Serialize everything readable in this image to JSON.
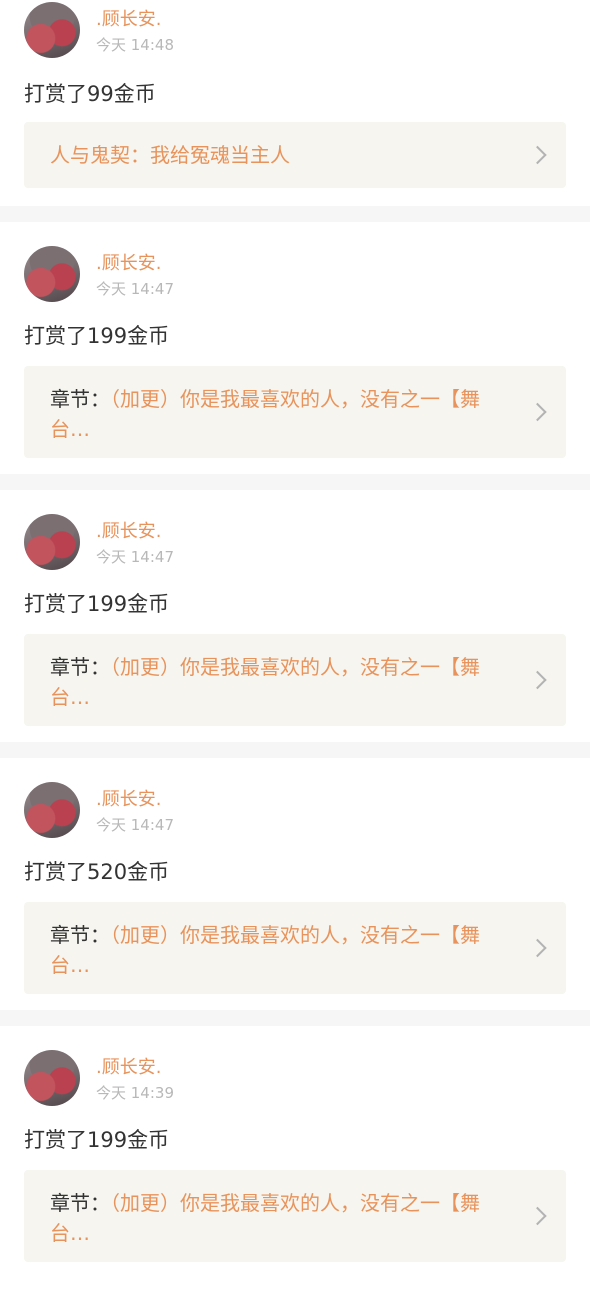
{
  "feed": [
    {
      "user": ".顾长安.",
      "time": "今天 14:48",
      "action": "打赏了99金币",
      "label": "",
      "title": "人与鬼契：我给冤魂当主人"
    },
    {
      "user": ".顾长安.",
      "time": "今天 14:47",
      "action": "打赏了199金币",
      "label": "章节：",
      "title": "（加更）你是我最喜欢的人，没有之一【舞台…"
    },
    {
      "user": ".顾长安.",
      "time": "今天 14:47",
      "action": "打赏了199金币",
      "label": "章节：",
      "title": "（加更）你是我最喜欢的人，没有之一【舞台…"
    },
    {
      "user": ".顾长安.",
      "time": "今天 14:47",
      "action": "打赏了520金币",
      "label": "章节：",
      "title": "（加更）你是我最喜欢的人，没有之一【舞台…"
    },
    {
      "user": ".顾长安.",
      "time": "今天 14:39",
      "action": "打赏了199金币",
      "label": "章节：",
      "title": "（加更）你是我最喜欢的人，没有之一【舞台…"
    }
  ]
}
